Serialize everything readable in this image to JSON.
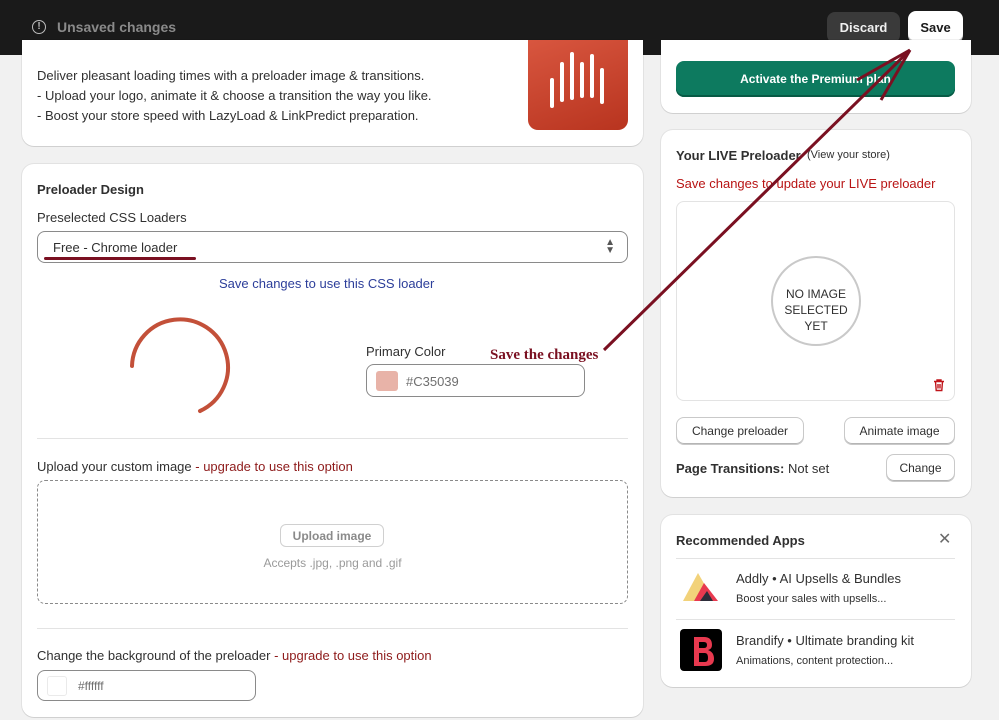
{
  "topbar": {
    "status": "Unsaved changes",
    "discard_label": "Discard",
    "save_label": "Save"
  },
  "intro": {
    "lines": [
      "Deliver pleasant loading times with a preloader image & transitions.",
      "- Upload your logo, animate it & choose a transition the way you like.",
      "- Boost your store speed with LazyLoad & LinkPredict preparation."
    ]
  },
  "design": {
    "heading": "Preloader Design",
    "select_label": "Preselected CSS Loaders",
    "select_value": "Free - Chrome loader",
    "save_css_link": "Save changes to use this CSS loader",
    "primary_color_label": "Primary Color",
    "primary_color_value": "#C35039",
    "annotation": "Save the changes",
    "upload_label": "Upload your custom image",
    "upgrade_text": "- upgrade to use this option",
    "upload_button": "Upload image",
    "accepts": "Accepts .jpg, .png and .gif",
    "bg_label": "Change the background of the preloader",
    "bg_value": "#ffffff"
  },
  "premium": {
    "button": "Activate the Premium plan"
  },
  "live": {
    "title": "Your LIVE Preloader",
    "view_link": "(View your store)",
    "warning": "Save changes to update your LIVE preloader",
    "no_image_line1": "NO IMAGE",
    "no_image_line2": "SELECTED YET",
    "change_preloader": "Change preloader",
    "animate_image": "Animate image",
    "page_transitions_label": "Page Transitions:",
    "page_transitions_value": "Not set",
    "change_button": "Change"
  },
  "recommended": {
    "title": "Recommended Apps",
    "apps": [
      {
        "name": "Addly • AI Upsells & Bundles",
        "desc": "Boost your sales with upsells..."
      },
      {
        "name": "Brandify • Ultimate branding kit",
        "desc": "Animations, content protection..."
      }
    ]
  },
  "colors": {
    "accent_primary": "#C35039",
    "premium_green": "#0d7a5f",
    "annotation": "#7a1021",
    "warning_red": "#b81414"
  }
}
